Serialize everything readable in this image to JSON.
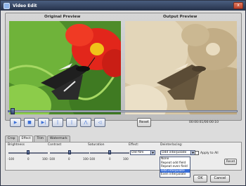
{
  "window": {
    "title": "Video Edit",
    "close_glyph": "x"
  },
  "preview": {
    "original_label": "Original Preview",
    "output_label": "Output Preview"
  },
  "playback": {
    "progress_fraction": 0.02,
    "buttons": [
      {
        "name": "play-button",
        "icon": "play-icon",
        "glyph": "▶"
      },
      {
        "name": "stop-button",
        "icon": "stop-icon",
        "glyph": "■"
      },
      {
        "name": "next-frame-button",
        "icon": "next-frame-icon",
        "glyph": "▶|"
      },
      {
        "name": "mark-in-button",
        "icon": "marker-icon",
        "glyph": "|"
      },
      {
        "name": "mark-out-button",
        "icon": "marker-icon",
        "glyph": "|"
      },
      {
        "name": "split-button",
        "icon": "split-icon",
        "glyph": "⋀"
      },
      {
        "name": "volume-button",
        "icon": "speaker-icon",
        "glyph": "◁"
      }
    ],
    "reset_label": "Reset",
    "timecode": "00:00:01/00:00:10"
  },
  "tabs": [
    "Crop",
    "Effect",
    "Trim",
    "Watermark"
  ],
  "active_tab": "Effect",
  "effect": {
    "brightness_label": "Brightness",
    "contrast_label": "Contrast",
    "saturation_label": "Saturation",
    "scale_min": "-100",
    "scale_mid": "0",
    "scale_max": "100",
    "brightness_value": 0,
    "contrast_value": 0,
    "saturation_value": 0,
    "effect_label": "Effect:",
    "effect_value": "Old film",
    "deinterlacing_label": "Deinterlacing:",
    "deinterlacing_value": "Odd interpolate",
    "deinterlacing_options": [
      "None",
      "Repeat odd field",
      "Repeat even field",
      "Odd interpolate",
      "Even interpolate"
    ],
    "apply_to_all_label": "Apply to All",
    "apply_to_all_checked": false,
    "reset_label": "Reset"
  },
  "footer": {
    "ok_label": "OK",
    "cancel_label": "Cancel",
    "apply_label": "Apply"
  },
  "colors": {
    "accent": "#3a6fd8",
    "title_bar": "#26324a",
    "output_sepia": "#c9b48f"
  }
}
